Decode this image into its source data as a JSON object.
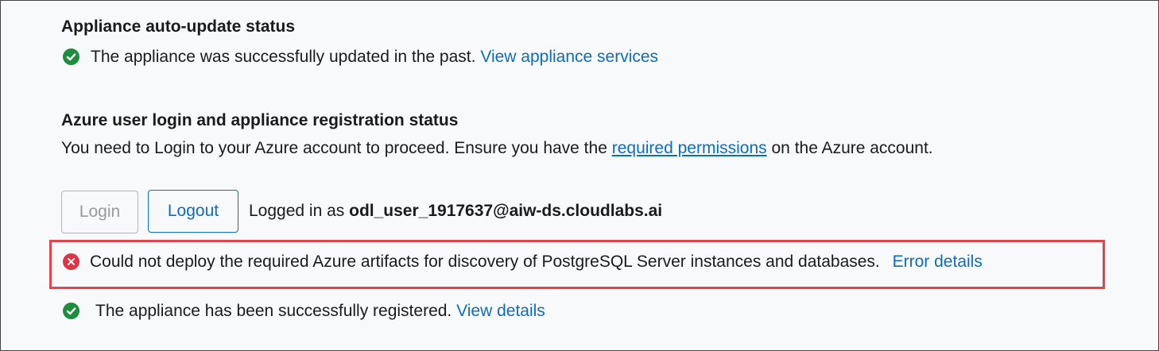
{
  "auto_update": {
    "title": "Appliance auto-update status",
    "status_text": "The appliance was successfully updated in the past.",
    "link": "View appliance services",
    "status_icon": "check-circle-icon"
  },
  "azure_login": {
    "title": "Azure user login and appliance registration status",
    "desc_before": "You need to Login to your Azure account to proceed. Ensure you have the",
    "desc_link": "required permissions",
    "desc_after": "on the Azure account.",
    "login_label": "Login",
    "logout_label": "Logout",
    "logged_in_prefix": "Logged in as",
    "user": "odl_user_1917637@aiw-ds.cloudlabs.ai"
  },
  "error": {
    "text": "Could not deploy the required Azure artifacts for discovery of PostgreSQL Server instances and databases.",
    "link": "Error details",
    "color": "#dc3545"
  },
  "registration": {
    "text": "The appliance has been successfully registered.",
    "link": "View details",
    "color": "#1e8e3e"
  }
}
